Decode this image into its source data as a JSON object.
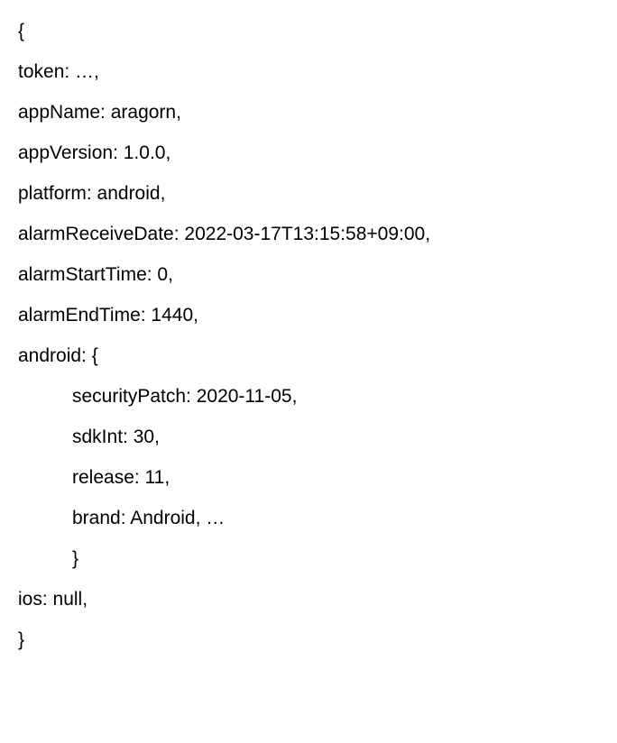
{
  "lines": {
    "l0": "{",
    "l1": "token: …,",
    "l2": "appName: aragorn,",
    "l3": "appVersion: 1.0.0,",
    "l4": "platform: android,",
    "l5": "alarmReceiveDate: 2022-03-17T13:15:58+09:00,",
    "l6": "alarmStartTime: 0,",
    "l7": "alarmEndTime: 1440,",
    "l8": "android: {",
    "l9": "securityPatch: 2020-11-05,",
    "l10": "sdkInt: 30,",
    "l11": "release: 11,",
    "l12": "brand: Android, …",
    "l13": "}",
    "l14": "ios: null,",
    "l15": "}"
  }
}
